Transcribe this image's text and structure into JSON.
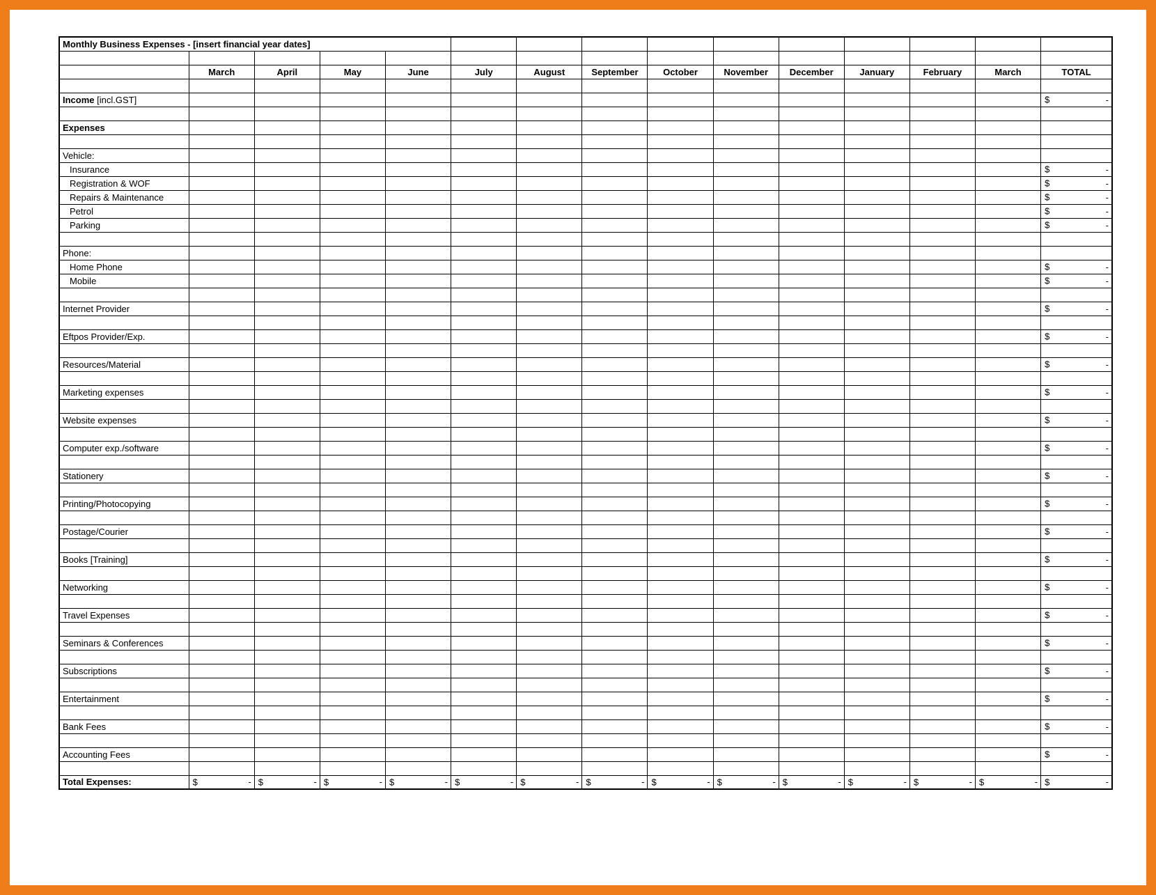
{
  "title": "Monthly Business Expenses - [insert financial year dates]",
  "months": [
    "March",
    "April",
    "May",
    "June",
    "July",
    "August",
    "September",
    "October",
    "November",
    "December",
    "January",
    "February",
    "March"
  ],
  "total_label": "TOTAL",
  "currency_symbol": "$",
  "dash": "-",
  "rows": [
    {
      "type": "blank"
    },
    {
      "type": "income",
      "label": "Income",
      "suffix": " [incl.GST]",
      "total_currency": true
    },
    {
      "type": "blank"
    },
    {
      "type": "bold",
      "label": "Expenses"
    },
    {
      "type": "blank"
    },
    {
      "type": "plain",
      "label": "Vehicle:"
    },
    {
      "type": "indent",
      "label": "Insurance",
      "total_currency": true
    },
    {
      "type": "indent",
      "label": "Registration & WOF",
      "total_currency": true
    },
    {
      "type": "indent",
      "label": "Repairs & Maintenance",
      "total_currency": true
    },
    {
      "type": "indent",
      "label": "Petrol",
      "total_currency": true
    },
    {
      "type": "indent",
      "label": "Parking",
      "total_currency": true
    },
    {
      "type": "blank"
    },
    {
      "type": "plain",
      "label": "Phone:"
    },
    {
      "type": "indent",
      "label": "Home Phone",
      "total_currency": true
    },
    {
      "type": "indent",
      "label": "Mobile",
      "total_currency": true
    },
    {
      "type": "blank"
    },
    {
      "type": "plain",
      "label": "Internet Provider",
      "total_currency": true
    },
    {
      "type": "blank"
    },
    {
      "type": "plain",
      "label": "Eftpos Provider/Exp.",
      "total_currency": true
    },
    {
      "type": "blank"
    },
    {
      "type": "plain",
      "label": "Resources/Material",
      "total_currency": true
    },
    {
      "type": "blank"
    },
    {
      "type": "plain",
      "label": "Marketing expenses",
      "total_currency": true
    },
    {
      "type": "blank"
    },
    {
      "type": "plain",
      "label": "Website expenses",
      "total_currency": true
    },
    {
      "type": "blank"
    },
    {
      "type": "plain",
      "label": "Computer exp./software",
      "total_currency": true
    },
    {
      "type": "blank"
    },
    {
      "type": "plain",
      "label": "Stationery",
      "total_currency": true
    },
    {
      "type": "blank"
    },
    {
      "type": "plain",
      "label": "Printing/Photocopying",
      "total_currency": true
    },
    {
      "type": "blank"
    },
    {
      "type": "plain",
      "label": "Postage/Courier",
      "total_currency": true
    },
    {
      "type": "blank"
    },
    {
      "type": "plain",
      "label": "Books [Training]",
      "total_currency": true
    },
    {
      "type": "blank"
    },
    {
      "type": "plain",
      "label": "Networking",
      "total_currency": true
    },
    {
      "type": "blank"
    },
    {
      "type": "plain",
      "label": "Travel Expenses",
      "total_currency": true
    },
    {
      "type": "blank"
    },
    {
      "type": "plain",
      "label": "Seminars & Conferences",
      "total_currency": true
    },
    {
      "type": "blank"
    },
    {
      "type": "plain",
      "label": "Subscriptions",
      "total_currency": true
    },
    {
      "type": "blank"
    },
    {
      "type": "plain",
      "label": "Entertainment",
      "total_currency": true
    },
    {
      "type": "blank"
    },
    {
      "type": "plain",
      "label": "Bank Fees",
      "total_currency": true
    },
    {
      "type": "blank"
    },
    {
      "type": "plain",
      "label": "Accounting Fees",
      "total_currency": true
    },
    {
      "type": "blank"
    },
    {
      "type": "total",
      "label": "Total Expenses:"
    }
  ]
}
